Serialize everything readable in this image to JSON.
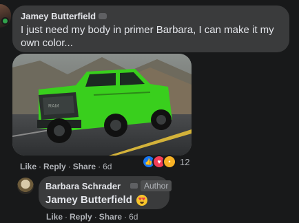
{
  "comment": {
    "author": "Jamey Butterfield",
    "text": "I just need my body in primer Barbara, I can make it my own color...",
    "photo_icon": "truck-photo",
    "actions": {
      "like": "Like",
      "reply": "Reply",
      "share": "Share",
      "time": "6d"
    },
    "reactions": {
      "icons": [
        "like-icon",
        "love-icon",
        "wow-icon"
      ],
      "count": "12"
    }
  },
  "reply": {
    "author": "Barbara Schrader",
    "badge": "Author",
    "mention": "Jamey Butterfield",
    "emoji": "heart-eyes-emoji",
    "actions": {
      "like": "Like",
      "reply": "Reply",
      "share": "Share",
      "time": "6d"
    }
  },
  "colors": {
    "background": "#18191a",
    "bubble": "#3a3b3c",
    "truck": "#3cd21e"
  }
}
